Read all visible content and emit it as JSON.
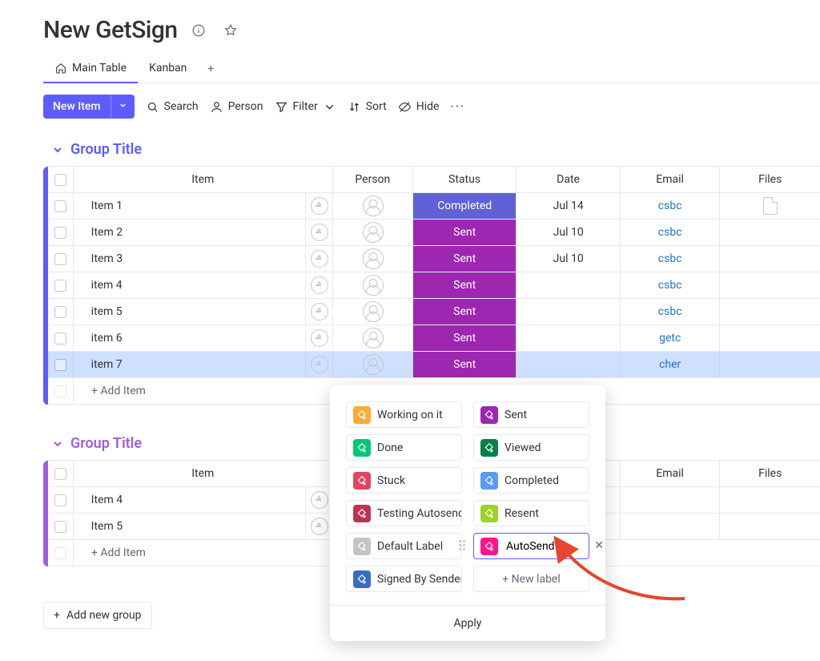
{
  "header": {
    "title": "New GetSign"
  },
  "tabs": {
    "main": "Main Table",
    "kanban": "Kanban"
  },
  "toolbar": {
    "newItem": "New Item",
    "search": "Search",
    "person": "Person",
    "filter": "Filter",
    "sort": "Sort",
    "hide": "Hide"
  },
  "columns": {
    "item": "Item",
    "person": "Person",
    "status": "Status",
    "date": "Date",
    "email": "Email",
    "files": "Files"
  },
  "groups": [
    {
      "title": "Group Title",
      "tone": "purple",
      "rows": [
        {
          "name": "Item 1",
          "status": "Completed",
          "statusClass": "status-completed",
          "date": "Jul 14",
          "email": "csbc",
          "file": true,
          "selected": false
        },
        {
          "name": "Item 2",
          "status": "Sent",
          "statusClass": "status-sent",
          "date": "Jul 10",
          "email": "csbc",
          "file": false,
          "selected": false
        },
        {
          "name": "Item 3",
          "status": "Sent",
          "statusClass": "status-sent",
          "date": "Jul 10",
          "email": "csbc",
          "file": false,
          "selected": false
        },
        {
          "name": "item 4",
          "status": "Sent",
          "statusClass": "status-sent",
          "date": "",
          "email": "csbc",
          "file": false,
          "selected": false
        },
        {
          "name": "item 5",
          "status": "Sent",
          "statusClass": "status-sent",
          "date": "",
          "email": "csbc",
          "file": false,
          "selected": false
        },
        {
          "name": "item 6",
          "status": "Sent",
          "statusClass": "status-sent",
          "date": "",
          "email": "getc",
          "file": false,
          "selected": false
        },
        {
          "name": "item 7",
          "status": "Sent",
          "statusClass": "status-sent",
          "date": "",
          "email": "cher",
          "file": false,
          "selected": true
        }
      ],
      "addItem": "+ Add Item"
    },
    {
      "title": "Group Title",
      "tone": "magenta",
      "rows": [
        {
          "name": "Item 4",
          "status": "",
          "statusClass": "",
          "date": "",
          "email": "",
          "file": false,
          "selected": false
        },
        {
          "name": "Item 5",
          "status": "",
          "statusClass": "",
          "date": "",
          "email": "",
          "file": false,
          "selected": false
        }
      ],
      "addItem": "+ Add Item"
    }
  ],
  "labelPanel": {
    "left": [
      {
        "label": "Working on it",
        "color": "#fdab3d"
      },
      {
        "label": "Done",
        "color": "#00c875"
      },
      {
        "label": "Stuck",
        "color": "#e2445c"
      },
      {
        "label": "Testing Autosend",
        "color": "#bb3354"
      },
      {
        "label": "Default Label",
        "color": "#c4c4c4"
      },
      {
        "label": "Signed By Sender",
        "color": "#3a6bc5"
      }
    ],
    "right": [
      {
        "label": "Sent",
        "color": "#9d27b0"
      },
      {
        "label": "Viewed",
        "color": "#037f4c"
      },
      {
        "label": "Completed",
        "color": "#579bfc"
      },
      {
        "label": "Resent",
        "color": "#9cd326"
      }
    ],
    "editingValue": "AutoSend",
    "editingColor": "#ff158a",
    "newLabel": "+ New label",
    "apply": "Apply"
  },
  "addGroup": "Add new group"
}
